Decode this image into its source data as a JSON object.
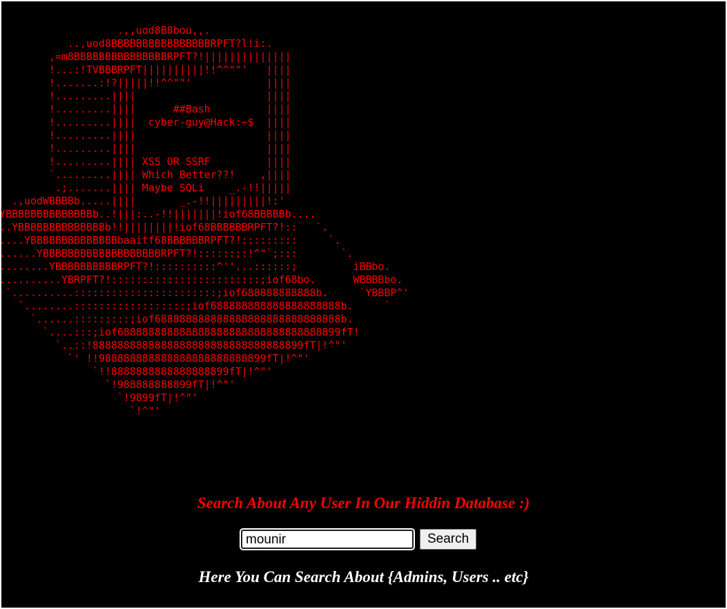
{
  "theme": {
    "background": "#000000",
    "ascii_color": "#ff0000",
    "heading_color": "#ff0000",
    "subheading_color": "#ffffff"
  },
  "ascii_art": "                    .,,uod8B8bou,,.\n            ..,uod8BBBBBBBBBBBBBBBBRPFT?l!i:.\n         ,=m8BBBBBBBBBBBBBBBRPFT?!||||||||||||||\n         !...:!TVBBBRPFT||||||||||!!^^\"\"'   ||||\n         !.......:!?|||||!!^^\"\"'            ||||\n         !.........||||                     ||||\n         !.........||||      ##Bash         ||||\n         !.........||||  cyber-guy@Hack:~$  ||||\n         !.........||||                     ||||\n         !.........||||                     ||||\n         !.........|||| XSS OR SSRF         ||||\n         `.........|||| Which Better??!    ,||||\n          .;.......|||| Maybe SQLi    _.-!!|||||\n   .,uodWBBBBb.....||||       _.-!!|||||||||!:'\n!YBBBBBBBBBBBBBBb..!|||:..-!!|||||||!iof68BBBBBb....\n!..YBBBBBBBBBBBBBBb!!||||||||!iof68BBBBBBRPFT?!::   `.\n!....YBBBBBBBBBBBBBBbaaitf68BBBBBBRPFT?!:::::::::     `.\n!......YBBBBBBBBBBBBBBBBBBBRPFT?!::::::;:!^\"`;:::       `.\n!........YBBBBBBBBBBRPFT?!::::::::::^''...::::::;         iBBbo.\n`..........YBRPFT?!::::::::::::::::::::::::;iof68bo.      WBBBBbo.\n  `..........:::::::::::::::::::::::;iof688888888888b.     `YBBBP^'\n    `........::::::::::::::::::;iof688888888888888888888b.     `\n      `......:::::::::;iof688888888888888888888888888888b.\n        `....:::;iof688888888888888888888888888888888899fT!\n          `..::!8888888888888888888888888888888899fT|!^\"'\n            `' !!988888888888888888888888899fT|!^\"'\n                `!!8888888888888888899fT|!^\"'\n                  `!988888888899fT|!^\"'\n                    `!9899fT|!^\"'\n                      `!^\"'",
  "heading": "Search About Any User In Our Hiddin Database :)",
  "search": {
    "value": "mounir",
    "button_label": "Search"
  },
  "subheading": "Here You Can Search About {Admins, Users .. etc}"
}
